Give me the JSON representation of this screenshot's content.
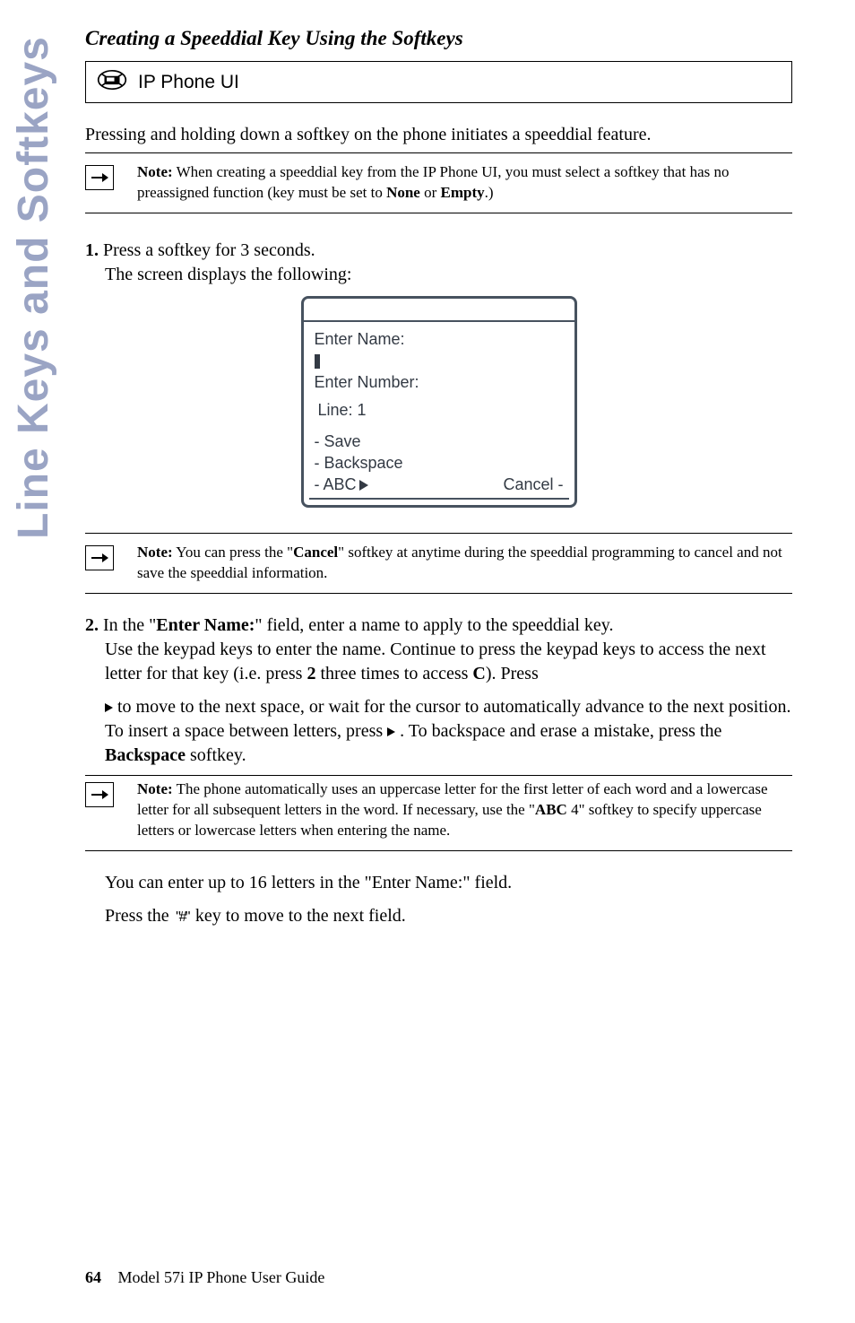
{
  "sidebar": {
    "label": "Line Keys and Softkeys"
  },
  "heading": {
    "title": "Creating a Speeddial Key Using the Softkeys"
  },
  "ipphone": {
    "label": "IP Phone UI"
  },
  "intro": {
    "text": "Pressing and holding down a softkey on the phone initiates a speeddial feature."
  },
  "note1": {
    "label": "Note:",
    "text_a": "When creating a speeddial key from the IP Phone UI, you must select a softkey that has no preassigned function (key must be set to ",
    "bold_a": "None",
    "text_b": " or ",
    "bold_b": "Empty",
    "text_c": ".)"
  },
  "step1": {
    "num": "1.",
    "line_a": "Press a softkey for 3 seconds.",
    "line_b": "The screen displays the following:"
  },
  "screen": {
    "enter_name": "Enter Name:",
    "enter_number": "Enter Number:",
    "line": "Line: 1",
    "save": "- Save",
    "backspace": "- Backspace",
    "abc": "- ABC",
    "cancel": "Cancel -"
  },
  "note2": {
    "label": "Note:",
    "text_a": "You can press the \"",
    "bold_a": "Cancel",
    "text_b": "\" softkey at anytime during the speeddial programming to cancel and not save the speeddial information."
  },
  "step2": {
    "num": "2.",
    "text_a": "In the \"",
    "bold_a": "Enter Name:",
    "text_b": "\" field, enter a name to apply to the speeddial key.",
    "line2": "Use the keypad keys to enter the name. Continue to press the keypad keys to access the next letter for that key (i.e. press ",
    "bold_b": "2",
    "line2b": " three times to access ",
    "bold_c": "C",
    "line2c": "). Press",
    "line3a": " to move to the next space, or wait for the cursor to automatically advance to the next position. To insert a space between letters, press ",
    "line3b": " . To backspace and erase a mistake, press the ",
    "bold_d": "Backspace",
    "line3c": " softkey."
  },
  "note3": {
    "label": "Note:",
    "text_a": "The phone automatically uses an uppercase letter for the first letter of each word and a lowercase letter for all subsequent letters in the word. If necessary, use the \"",
    "bold_a": "ABC",
    "text_b": " 4\" softkey to specify uppercase letters or lowercase letters when entering the name."
  },
  "post": {
    "line1": "You can enter up to 16 letters in the \"Enter Name:\" field.",
    "line2a": "Press the ",
    "line2b": " key to move to the next field."
  },
  "footer": {
    "page": "64",
    "book": "Model 57i IP Phone User Guide"
  }
}
